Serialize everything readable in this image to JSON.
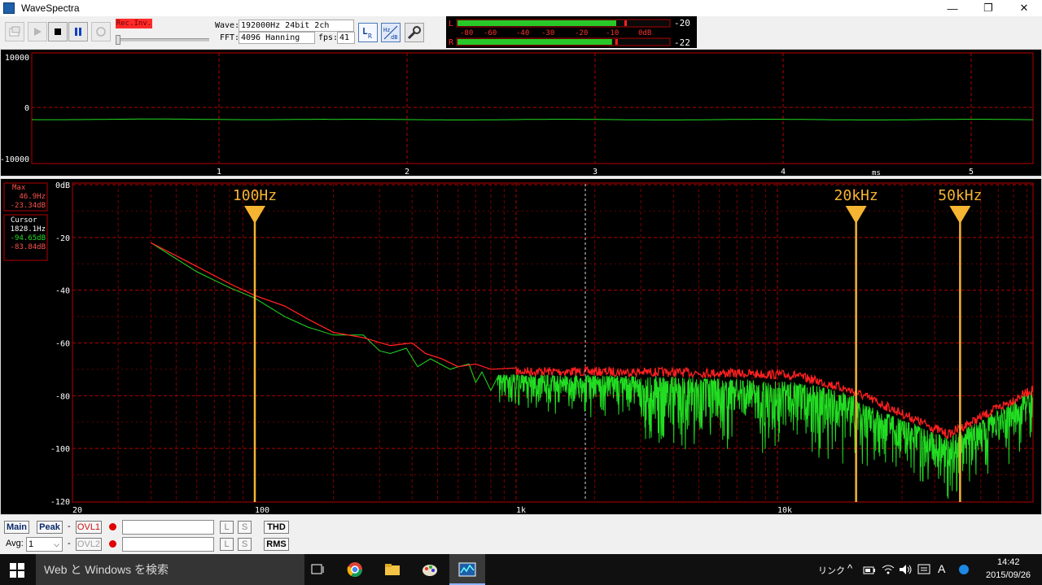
{
  "window": {
    "title": "WaveSpectra",
    "minimize": "—",
    "restore": "❐",
    "close": "✕"
  },
  "toolbar": {
    "rec_inv": "Rec.Inv.",
    "wave_label": "Wave:",
    "wave_value": "192000Hz 24bit 2ch",
    "fft_label": "FFT:",
    "fft_value": "4096 Hanning",
    "fps_label": "fps:",
    "fps_value": "41",
    "lr_label": "LR",
    "hz_label": "Hz",
    "db_label": "dB"
  },
  "level_meter": {
    "L_label": "L",
    "R_label": "R",
    "L_value": "-20",
    "R_value": "-22",
    "scale": [
      "-80",
      "-60",
      "-40",
      "-30",
      "-20",
      "-10",
      "0dB"
    ],
    "L_fill": 0.75,
    "R_fill": 0.73
  },
  "waveform": {
    "y_ticks": [
      "10000",
      "0",
      "-10000"
    ],
    "x_ticks": [
      "1",
      "2",
      "3",
      "4",
      "5"
    ],
    "x_unit": "ms"
  },
  "spectrum": {
    "y_ticks": [
      "0dB",
      "-20",
      "-40",
      "-60",
      "-80",
      "-100",
      "-120"
    ],
    "x_ticks": [
      "20",
      "100",
      "1k",
      "10k"
    ],
    "max_box": {
      "title": "Max",
      "freq": "46.9Hz",
      "level": "-23.34dB"
    },
    "cursor_box": {
      "title": "Cursor",
      "freq": "1828.1Hz",
      "level_l": "-94.65dB",
      "level_r": "-83.84dB"
    },
    "markers": [
      "100Hz",
      "20kHz",
      "50kHz"
    ]
  },
  "bottom": {
    "main": "Main",
    "peak": "Peak",
    "ovl1": "OVL1",
    "ovl2": "OVL2",
    "dash": "-",
    "l": "L",
    "s": "S",
    "thd": "THD",
    "rms": "RMS",
    "avg_label": "Avg:",
    "avg_value": "1"
  },
  "taskbar": {
    "search_placeholder": "Web と Windows を検索",
    "link": "リンク",
    "ime": "A",
    "time": "14:42",
    "date": "2015/09/26"
  },
  "colors": {
    "grid": "#b40000",
    "trace_left": "#22dd22",
    "trace_right": "#ff2020",
    "marker": "#f5b431",
    "axis_text": "#ffffff"
  }
}
